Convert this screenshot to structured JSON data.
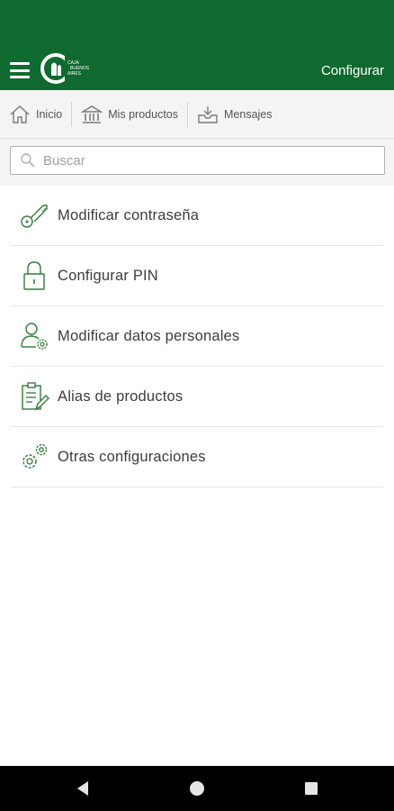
{
  "header": {
    "logo_text": [
      "CAJA",
      "BUENOS",
      "AIRES"
    ],
    "action_label": "Configurar"
  },
  "nav": {
    "items": [
      {
        "label": "Inicio",
        "icon": "home-icon"
      },
      {
        "label": "Mis productos",
        "icon": "bank-icon"
      },
      {
        "label": "Mensajes",
        "icon": "inbox-icon"
      }
    ]
  },
  "search": {
    "placeholder": "Buscar"
  },
  "menu": {
    "items": [
      {
        "label": "Modificar contraseña",
        "icon": "key-icon"
      },
      {
        "label": "Configurar PIN",
        "icon": "lock-icon"
      },
      {
        "label": "Modificar datos personales",
        "icon": "user-settings-icon"
      },
      {
        "label": "Alias de productos",
        "icon": "clipboard-edit-icon"
      },
      {
        "label": "Otras configuraciones",
        "icon": "gears-icon"
      }
    ]
  },
  "colors": {
    "brand_green": "#0f6a2f",
    "icon_green": "#2e7d3a",
    "navbar_bg": "#f4f4f4"
  }
}
